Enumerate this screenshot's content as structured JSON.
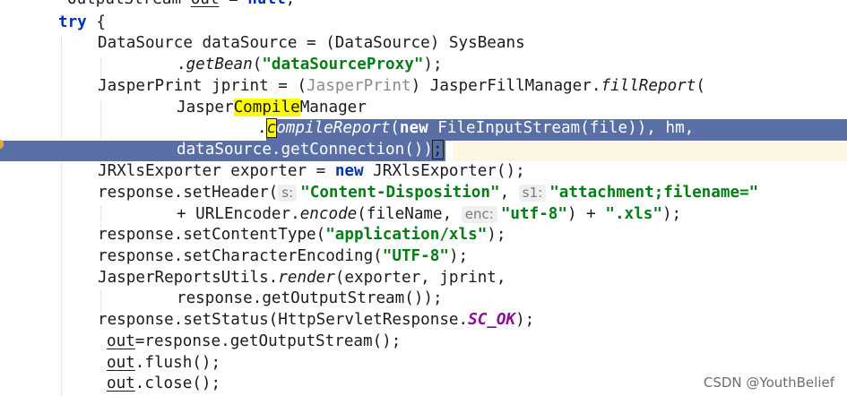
{
  "code": {
    "line0": {
      "a": "OutputStream ",
      "b": "out",
      "c": " = ",
      "d": "null",
      "e": ";"
    },
    "line1": {
      "kw": "try",
      "rest": " {"
    },
    "line2": {
      "text": "DataSource dataSource = (DataSource) SysBeans"
    },
    "line3": {
      "dot": ".",
      "method": "getBean",
      "open": "(",
      "str": "\"dataSourceProxy\"",
      "close": ");"
    },
    "line4": {
      "a": "JasperPrint jprint = (",
      "cast": "JasperPrint",
      "b": ") JasperFillManager.",
      "method": "fillReport",
      "c": "("
    },
    "line5": {
      "a": "Jasper",
      "hl": "Compile",
      "b": "Manager"
    },
    "line6": {
      "dot": ".",
      "caret": "c",
      "method": "ompileReport",
      "open": "(",
      "kw": "new",
      "rest": " FileInputStream(file)), hm,"
    },
    "line7": {
      "a": "dataSource.getConnection())",
      "b": ";"
    },
    "line8": {
      "a": "JRXlsExporter exporter = ",
      "kw": "new",
      "b": " JRXlsExporter();"
    },
    "line9": {
      "a": "response.setHeader(",
      "hint1": "s:",
      "str1": "\"Content-Disposition\"",
      "comma": ",",
      "hint2": "s1:",
      "str2": "\"attachment;filename=\""
    },
    "line10": {
      "a": "+ URLEncoder.",
      "method": "encode",
      "b": "(fileName, ",
      "hint": "enc:",
      "str1": "\"utf-8\"",
      "c": ") + ",
      "str2": "\".xls\"",
      "d": ");"
    },
    "line11": {
      "a": "response.setContentType(",
      "str": "\"application/xls\"",
      "b": ");"
    },
    "line12": {
      "a": "response.setCharacterEncoding(",
      "str": "\"UTF-8\"",
      "b": ");"
    },
    "line13": {
      "a": "JasperReportsUtils.",
      "method": "render",
      "b": "(exporter, jprint,"
    },
    "line14": {
      "text": "response.getOutputStream());"
    },
    "line15": {
      "a": "response.setStatus(HttpServletResponse.",
      "const": "SC_OK",
      "b": ");"
    },
    "line16": {
      "var": "out",
      "rest": "=response.getOutputStream();"
    },
    "line17": {
      "var": "out",
      "rest": ".flush();"
    },
    "line18": {
      "var": "out",
      "rest": ".close();"
    }
  },
  "watermark": "CSDN @YouthBelief",
  "colors": {
    "keyword": "#0033b3",
    "string": "#067d17",
    "constant": "#871094",
    "selection": "#5a6fa6",
    "highlight": "#ffff00",
    "current_line": "#fdf6e3"
  }
}
